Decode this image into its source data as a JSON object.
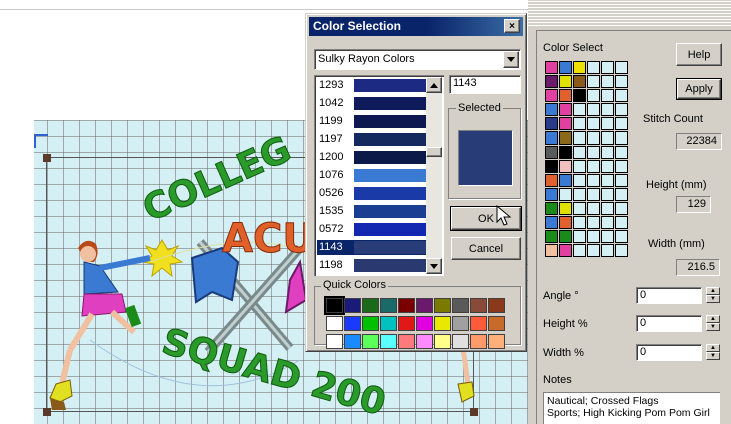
{
  "dialog": {
    "title": "Color Selection",
    "close_label": "×",
    "thread_family": "Sulky Rayon Colors",
    "code_value": "1143",
    "selected_label": "Selected",
    "selected_color": "#283c78",
    "ok_label": "OK",
    "cancel_label": "Cancel",
    "quick_colors_label": "Quick Colors",
    "color_list": [
      {
        "code": "1293",
        "color": "#1c2a84",
        "selected": false
      },
      {
        "code": "1042",
        "color": "#0f1a5a",
        "selected": false
      },
      {
        "code": "1199",
        "color": "#0d1850",
        "selected": false
      },
      {
        "code": "1197",
        "color": "#142a5e",
        "selected": false
      },
      {
        "code": "1200",
        "color": "#0c1a4a",
        "selected": false
      },
      {
        "code": "1076",
        "color": "#3a7ad2",
        "selected": false
      },
      {
        "code": "0526",
        "color": "#1a3aa8",
        "selected": false
      },
      {
        "code": "1535",
        "color": "#1a3e92",
        "selected": false
      },
      {
        "code": "0572",
        "color": "#1228b0",
        "selected": false
      },
      {
        "code": "1143",
        "color": "#283c78",
        "selected": true
      },
      {
        "code": "1198",
        "color": "#2a3a70",
        "selected": false
      }
    ],
    "quick_colors": [
      "#000000",
      "#1a1a78",
      "#1a6a1a",
      "#1a6a6a",
      "#7a0000",
      "#6a1a6a",
      "#7a7a00",
      "#5a5a5a",
      "#8a4a3a",
      "#8a3a1a",
      "#ffffff",
      "#1a3aff",
      "#00c000",
      "#00c0c0",
      "#e01818",
      "#e000e0",
      "#e8e800",
      "#a0a0a0",
      "#ff5a3a",
      "#c86a2a",
      "#ffffff",
      "#1a8aff",
      "#5aff5a",
      "#5affff",
      "#ff7a7a",
      "#ff8aff",
      "#ffff8a",
      "#e0e0e0",
      "#ff9a6a",
      "#ffb07a"
    ]
  },
  "right_panel": {
    "color_select_label": "Color Select",
    "help_label": "Help",
    "apply_label": "Apply",
    "stitch_count_label": "Stitch Count",
    "stitch_count_value": "22384",
    "height_mm_label": "Height (mm)",
    "height_mm_value": "129",
    "width_mm_label": "Width (mm)",
    "width_mm_value": "216.5",
    "angle_label": "Angle °",
    "angle_value": "0",
    "height_pct_label": "Height %",
    "height_pct_value": "0",
    "width_pct_label": "Width %",
    "width_pct_value": "0",
    "notes_label": "Notes",
    "notes_line1": "Nautical; Crossed Flags",
    "notes_line2": "Sports; High Kicking Pom Pom Girl",
    "color_select_cells": [
      "#e040a0",
      "#3a7ad2",
      "#f0e000",
      "#d4f0f4",
      "#d4f0f4",
      "#d4f0f4",
      "#6a1a6a",
      "#e0e000",
      "#8a5a1a",
      "#d4f0f4",
      "#d4f0f4",
      "#d4f0f4",
      "#e040a0",
      "#e06030",
      "#000000",
      "#d4f0f4",
      "#d4f0f4",
      "#d4f0f4",
      "#3a7ad2",
      "#e040a0",
      "#d4f0f4",
      "#d4f0f4",
      "#d4f0f4",
      "#d4f0f4",
      "#2a3a8a",
      "#e040a0",
      "#d4f0f4",
      "#d4f0f4",
      "#d4f0f4",
      "#d4f0f4",
      "#3a7ad2",
      "#8a6a1a",
      "#d4f0f4",
      "#d4f0f4",
      "#d4f0f4",
      "#d4f0f4",
      "#5a5a5a",
      "#000000",
      "#d4f0f4",
      "#d4f0f4",
      "#d4f0f4",
      "#d4f0f4",
      "#000000",
      "#f0c0c0",
      "#d4f0f4",
      "#d4f0f4",
      "#d4f0f4",
      "#d4f0f4",
      "#e06030",
      "#3a7ad2",
      "#d4f0f4",
      "#d4f0f4",
      "#d4f0f4",
      "#d4f0f4",
      "#3a7ad2",
      "#d4f0f4",
      "#d4f0f4",
      "#d4f0f4",
      "#d4f0f4",
      "#d4f0f4",
      "#1a8a1a",
      "#e0e000",
      "#d4f0f4",
      "#d4f0f4",
      "#d4f0f4",
      "#d4f0f4",
      "#3a7ad2",
      "#e06030",
      "#d4f0f4",
      "#d4f0f4",
      "#d4f0f4",
      "#d4f0f4",
      "#1a8a1a",
      "#1a8a1a",
      "#d4f0f4",
      "#d4f0f4",
      "#d4f0f4",
      "#d4f0f4",
      "#f0c0a0",
      "#e040a0",
      "#d4f0f4",
      "#d4f0f4",
      "#d4f0f4",
      "#d4f0f4"
    ]
  },
  "design": {
    "text_top": "COLLEG",
    "text_mid": "ACU",
    "text_bottom": "SQUAD 200",
    "colors": {
      "green_text": "#2a9a2a",
      "orange_text": "#e0602a",
      "flag_blue": "#3a7ad2",
      "flag_pink": "#e040c0",
      "spark_yellow": "#f0e020",
      "grid_bg": "#d4f0f4"
    }
  }
}
